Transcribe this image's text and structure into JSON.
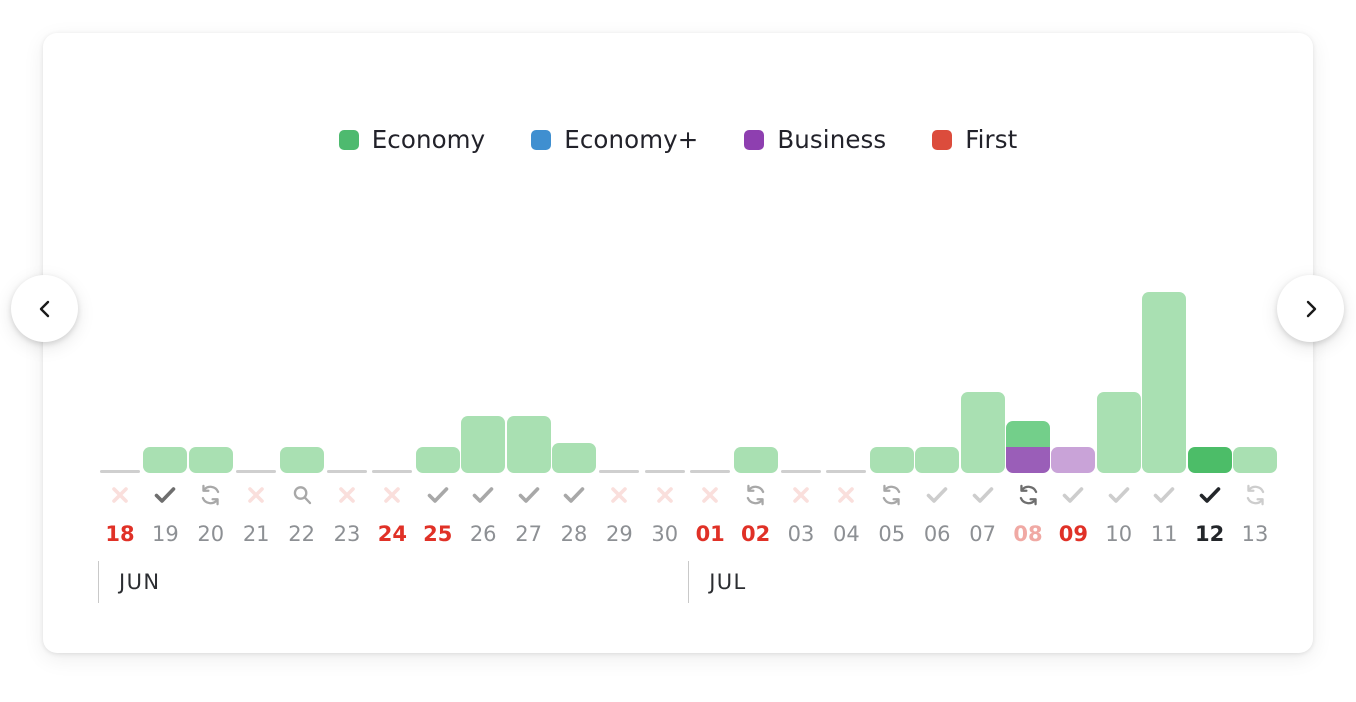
{
  "legend": {
    "items": [
      {
        "label": "Economy",
        "color": "#4eba6f",
        "name": "legend-item-economy"
      },
      {
        "label": "Economy+",
        "color": "#3f8fd0",
        "name": "legend-item-economy-plus"
      },
      {
        "label": "Business",
        "color": "#8e3fb0",
        "name": "legend-item-business"
      },
      {
        "label": "First",
        "color": "#dc4c3c",
        "name": "legend-item-first"
      }
    ]
  },
  "nav": {
    "prev_label": "‹",
    "prev_icon": "chevron-left-icon",
    "next_label": "›",
    "next_icon": "chevron-right-icon"
  },
  "months": [
    {
      "label": "JUN",
      "start_index": 0,
      "span": 13
    },
    {
      "label": "JUL",
      "start_index": 13,
      "span": 13
    }
  ],
  "chart_data": {
    "type": "bar",
    "title": "",
    "xlabel": "",
    "ylabel": "",
    "grid": false,
    "stacked": true,
    "legend_position": "top-center",
    "ylim": [
      0,
      200
    ],
    "categories": [
      "18",
      "19",
      "20",
      "21",
      "22",
      "23",
      "24",
      "25",
      "26",
      "27",
      "28",
      "29",
      "30",
      "01",
      "02",
      "03",
      "04",
      "05",
      "06",
      "07",
      "08",
      "09",
      "10",
      "11",
      "12",
      "13"
    ],
    "series": [
      {
        "name": "Economy",
        "color": "#a9e0b2",
        "values": [
          0,
          26,
          26,
          0,
          26,
          0,
          0,
          26,
          57,
          57,
          30,
          0,
          0,
          0,
          26,
          0,
          0,
          26,
          26,
          81,
          26,
          0,
          81,
          181,
          26,
          26
        ]
      },
      {
        "name": "Business",
        "color": "#9a5eb8",
        "values": [
          0,
          0,
          0,
          0,
          0,
          0,
          0,
          0,
          0,
          0,
          0,
          0,
          0,
          0,
          0,
          0,
          0,
          0,
          0,
          0,
          26,
          26,
          0,
          0,
          0,
          0
        ]
      }
    ],
    "bar_states": [
      {
        "date": "18",
        "status": "x",
        "status_tone": "muted",
        "date_tone": "weekend",
        "bar_tone": "none"
      },
      {
        "date": "19",
        "status": "check",
        "status_tone": "dark",
        "date_tone": "normal",
        "bar_tone": "economy-light"
      },
      {
        "date": "20",
        "status": "refresh",
        "status_tone": "mid",
        "date_tone": "normal",
        "bar_tone": "economy-light"
      },
      {
        "date": "21",
        "status": "x",
        "status_tone": "muted",
        "date_tone": "normal",
        "bar_tone": "none"
      },
      {
        "date": "22",
        "status": "search",
        "status_tone": "mid",
        "date_tone": "normal",
        "bar_tone": "economy-light"
      },
      {
        "date": "23",
        "status": "x",
        "status_tone": "muted",
        "date_tone": "normal",
        "bar_tone": "none"
      },
      {
        "date": "24",
        "status": "x",
        "status_tone": "muted",
        "date_tone": "weekend",
        "bar_tone": "none"
      },
      {
        "date": "25",
        "status": "check",
        "status_tone": "mid",
        "date_tone": "weekend",
        "bar_tone": "economy-light"
      },
      {
        "date": "26",
        "status": "check",
        "status_tone": "mid",
        "date_tone": "normal",
        "bar_tone": "economy-light"
      },
      {
        "date": "27",
        "status": "check",
        "status_tone": "mid",
        "date_tone": "normal",
        "bar_tone": "economy-light"
      },
      {
        "date": "28",
        "status": "check",
        "status_tone": "mid",
        "date_tone": "normal",
        "bar_tone": "economy-light"
      },
      {
        "date": "29",
        "status": "x",
        "status_tone": "muted",
        "date_tone": "normal",
        "bar_tone": "none"
      },
      {
        "date": "30",
        "status": "x",
        "status_tone": "muted",
        "date_tone": "normal",
        "bar_tone": "none"
      },
      {
        "date": "01",
        "status": "x",
        "status_tone": "muted",
        "date_tone": "weekend",
        "bar_tone": "none"
      },
      {
        "date": "02",
        "status": "refresh",
        "status_tone": "mid",
        "date_tone": "weekend",
        "bar_tone": "economy-light"
      },
      {
        "date": "03",
        "status": "x",
        "status_tone": "muted",
        "date_tone": "normal",
        "bar_tone": "none"
      },
      {
        "date": "04",
        "status": "x",
        "status_tone": "muted",
        "date_tone": "normal",
        "bar_tone": "none"
      },
      {
        "date": "05",
        "status": "refresh",
        "status_tone": "mid",
        "date_tone": "normal",
        "bar_tone": "economy-light"
      },
      {
        "date": "06",
        "status": "check",
        "status_tone": "light",
        "date_tone": "normal",
        "bar_tone": "economy-light"
      },
      {
        "date": "07",
        "status": "check",
        "status_tone": "light",
        "date_tone": "normal",
        "bar_tone": "economy-light"
      },
      {
        "date": "08",
        "status": "refresh",
        "status_tone": "dark",
        "date_tone": "weekend-muted",
        "bar_tone": "stacked"
      },
      {
        "date": "09",
        "status": "check",
        "status_tone": "light",
        "date_tone": "weekend",
        "bar_tone": "business-light"
      },
      {
        "date": "10",
        "status": "check",
        "status_tone": "light",
        "date_tone": "normal",
        "bar_tone": "economy-light"
      },
      {
        "date": "11",
        "status": "check",
        "status_tone": "light",
        "date_tone": "normal",
        "bar_tone": "economy-light"
      },
      {
        "date": "12",
        "status": "check",
        "status_tone": "black",
        "date_tone": "selected",
        "bar_tone": "economy-strong"
      },
      {
        "date": "13",
        "status": "refresh",
        "status_tone": "light",
        "date_tone": "normal",
        "bar_tone": "economy-light"
      }
    ]
  },
  "colors": {
    "economy_light": "#a9e0b2",
    "economy_mid": "#73cf8a",
    "economy_strong": "#4cbd68",
    "business_strong": "#9a5eb8",
    "business_light": "#c9a3d8",
    "zero_tick": "#cfcfcf",
    "x_muted": "#fadfdc",
    "icon_light": "#cdcdcd",
    "icon_mid": "#a8a8a8",
    "icon_dark": "#6e6e6e",
    "icon_black": "#23262a",
    "date_normal": "#8d9094",
    "date_weekend": "#e03127",
    "date_weekend_muted": "#f0a9a4",
    "date_selected": "#23262a",
    "card_bg": "#ffffff"
  }
}
